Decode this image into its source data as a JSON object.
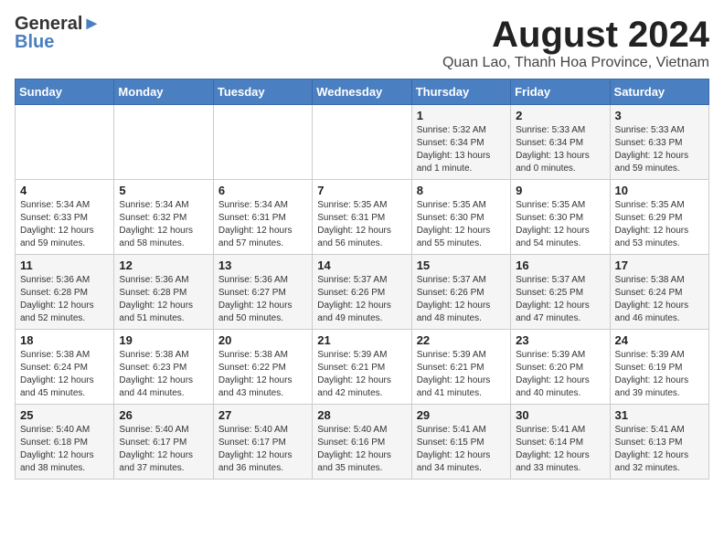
{
  "logo": {
    "line1": "General",
    "line2": "Blue"
  },
  "title": "August 2024",
  "subtitle": "Quan Lao, Thanh Hoa Province, Vietnam",
  "headers": [
    "Sunday",
    "Monday",
    "Tuesday",
    "Wednesday",
    "Thursday",
    "Friday",
    "Saturday"
  ],
  "weeks": [
    [
      {
        "day": "",
        "info": ""
      },
      {
        "day": "",
        "info": ""
      },
      {
        "day": "",
        "info": ""
      },
      {
        "day": "",
        "info": ""
      },
      {
        "day": "1",
        "info": "Sunrise: 5:32 AM\nSunset: 6:34 PM\nDaylight: 13 hours\nand 1 minute."
      },
      {
        "day": "2",
        "info": "Sunrise: 5:33 AM\nSunset: 6:34 PM\nDaylight: 13 hours\nand 0 minutes."
      },
      {
        "day": "3",
        "info": "Sunrise: 5:33 AM\nSunset: 6:33 PM\nDaylight: 12 hours\nand 59 minutes."
      }
    ],
    [
      {
        "day": "4",
        "info": "Sunrise: 5:34 AM\nSunset: 6:33 PM\nDaylight: 12 hours\nand 59 minutes."
      },
      {
        "day": "5",
        "info": "Sunrise: 5:34 AM\nSunset: 6:32 PM\nDaylight: 12 hours\nand 58 minutes."
      },
      {
        "day": "6",
        "info": "Sunrise: 5:34 AM\nSunset: 6:31 PM\nDaylight: 12 hours\nand 57 minutes."
      },
      {
        "day": "7",
        "info": "Sunrise: 5:35 AM\nSunset: 6:31 PM\nDaylight: 12 hours\nand 56 minutes."
      },
      {
        "day": "8",
        "info": "Sunrise: 5:35 AM\nSunset: 6:30 PM\nDaylight: 12 hours\nand 55 minutes."
      },
      {
        "day": "9",
        "info": "Sunrise: 5:35 AM\nSunset: 6:30 PM\nDaylight: 12 hours\nand 54 minutes."
      },
      {
        "day": "10",
        "info": "Sunrise: 5:35 AM\nSunset: 6:29 PM\nDaylight: 12 hours\nand 53 minutes."
      }
    ],
    [
      {
        "day": "11",
        "info": "Sunrise: 5:36 AM\nSunset: 6:28 PM\nDaylight: 12 hours\nand 52 minutes."
      },
      {
        "day": "12",
        "info": "Sunrise: 5:36 AM\nSunset: 6:28 PM\nDaylight: 12 hours\nand 51 minutes."
      },
      {
        "day": "13",
        "info": "Sunrise: 5:36 AM\nSunset: 6:27 PM\nDaylight: 12 hours\nand 50 minutes."
      },
      {
        "day": "14",
        "info": "Sunrise: 5:37 AM\nSunset: 6:26 PM\nDaylight: 12 hours\nand 49 minutes."
      },
      {
        "day": "15",
        "info": "Sunrise: 5:37 AM\nSunset: 6:26 PM\nDaylight: 12 hours\nand 48 minutes."
      },
      {
        "day": "16",
        "info": "Sunrise: 5:37 AM\nSunset: 6:25 PM\nDaylight: 12 hours\nand 47 minutes."
      },
      {
        "day": "17",
        "info": "Sunrise: 5:38 AM\nSunset: 6:24 PM\nDaylight: 12 hours\nand 46 minutes."
      }
    ],
    [
      {
        "day": "18",
        "info": "Sunrise: 5:38 AM\nSunset: 6:24 PM\nDaylight: 12 hours\nand 45 minutes."
      },
      {
        "day": "19",
        "info": "Sunrise: 5:38 AM\nSunset: 6:23 PM\nDaylight: 12 hours\nand 44 minutes."
      },
      {
        "day": "20",
        "info": "Sunrise: 5:38 AM\nSunset: 6:22 PM\nDaylight: 12 hours\nand 43 minutes."
      },
      {
        "day": "21",
        "info": "Sunrise: 5:39 AM\nSunset: 6:21 PM\nDaylight: 12 hours\nand 42 minutes."
      },
      {
        "day": "22",
        "info": "Sunrise: 5:39 AM\nSunset: 6:21 PM\nDaylight: 12 hours\nand 41 minutes."
      },
      {
        "day": "23",
        "info": "Sunrise: 5:39 AM\nSunset: 6:20 PM\nDaylight: 12 hours\nand 40 minutes."
      },
      {
        "day": "24",
        "info": "Sunrise: 5:39 AM\nSunset: 6:19 PM\nDaylight: 12 hours\nand 39 minutes."
      }
    ],
    [
      {
        "day": "25",
        "info": "Sunrise: 5:40 AM\nSunset: 6:18 PM\nDaylight: 12 hours\nand 38 minutes."
      },
      {
        "day": "26",
        "info": "Sunrise: 5:40 AM\nSunset: 6:17 PM\nDaylight: 12 hours\nand 37 minutes."
      },
      {
        "day": "27",
        "info": "Sunrise: 5:40 AM\nSunset: 6:17 PM\nDaylight: 12 hours\nand 36 minutes."
      },
      {
        "day": "28",
        "info": "Sunrise: 5:40 AM\nSunset: 6:16 PM\nDaylight: 12 hours\nand 35 minutes."
      },
      {
        "day": "29",
        "info": "Sunrise: 5:41 AM\nSunset: 6:15 PM\nDaylight: 12 hours\nand 34 minutes."
      },
      {
        "day": "30",
        "info": "Sunrise: 5:41 AM\nSunset: 6:14 PM\nDaylight: 12 hours\nand 33 minutes."
      },
      {
        "day": "31",
        "info": "Sunrise: 5:41 AM\nSunset: 6:13 PM\nDaylight: 12 hours\nand 32 minutes."
      }
    ]
  ]
}
